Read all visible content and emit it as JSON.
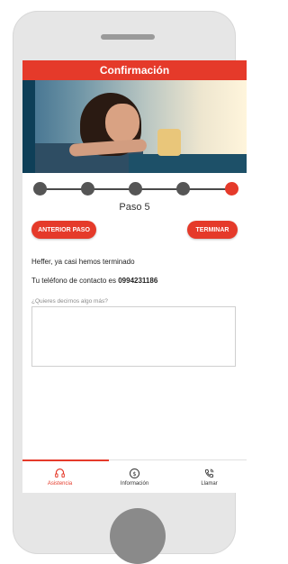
{
  "header": {
    "title": "Confirmación"
  },
  "stepper": {
    "label": "Paso 5",
    "total_steps": 5,
    "current_step": 5
  },
  "actions": {
    "back_label": "ANTERIOR PASO",
    "finish_label": "TERMINAR"
  },
  "content": {
    "message_line": "Heffer, ya casi hemos terminado",
    "phone_prefix": "Tu teléfono de contacto es ",
    "phone_number": "0994231186",
    "textarea_placeholder": "¿Quieres decirnos algo más?",
    "textarea_value": ""
  },
  "bottom_nav": {
    "items": [
      {
        "label": "Asistencia",
        "icon": "headset-icon",
        "active": true
      },
      {
        "label": "Información",
        "icon": "dollar-info-icon",
        "active": false
      },
      {
        "label": "Llamar",
        "icon": "phone-call-icon",
        "active": false
      }
    ]
  },
  "colors": {
    "accent": "#e53a2a",
    "step_inactive": "#555555",
    "device": "#e6e6e6"
  }
}
